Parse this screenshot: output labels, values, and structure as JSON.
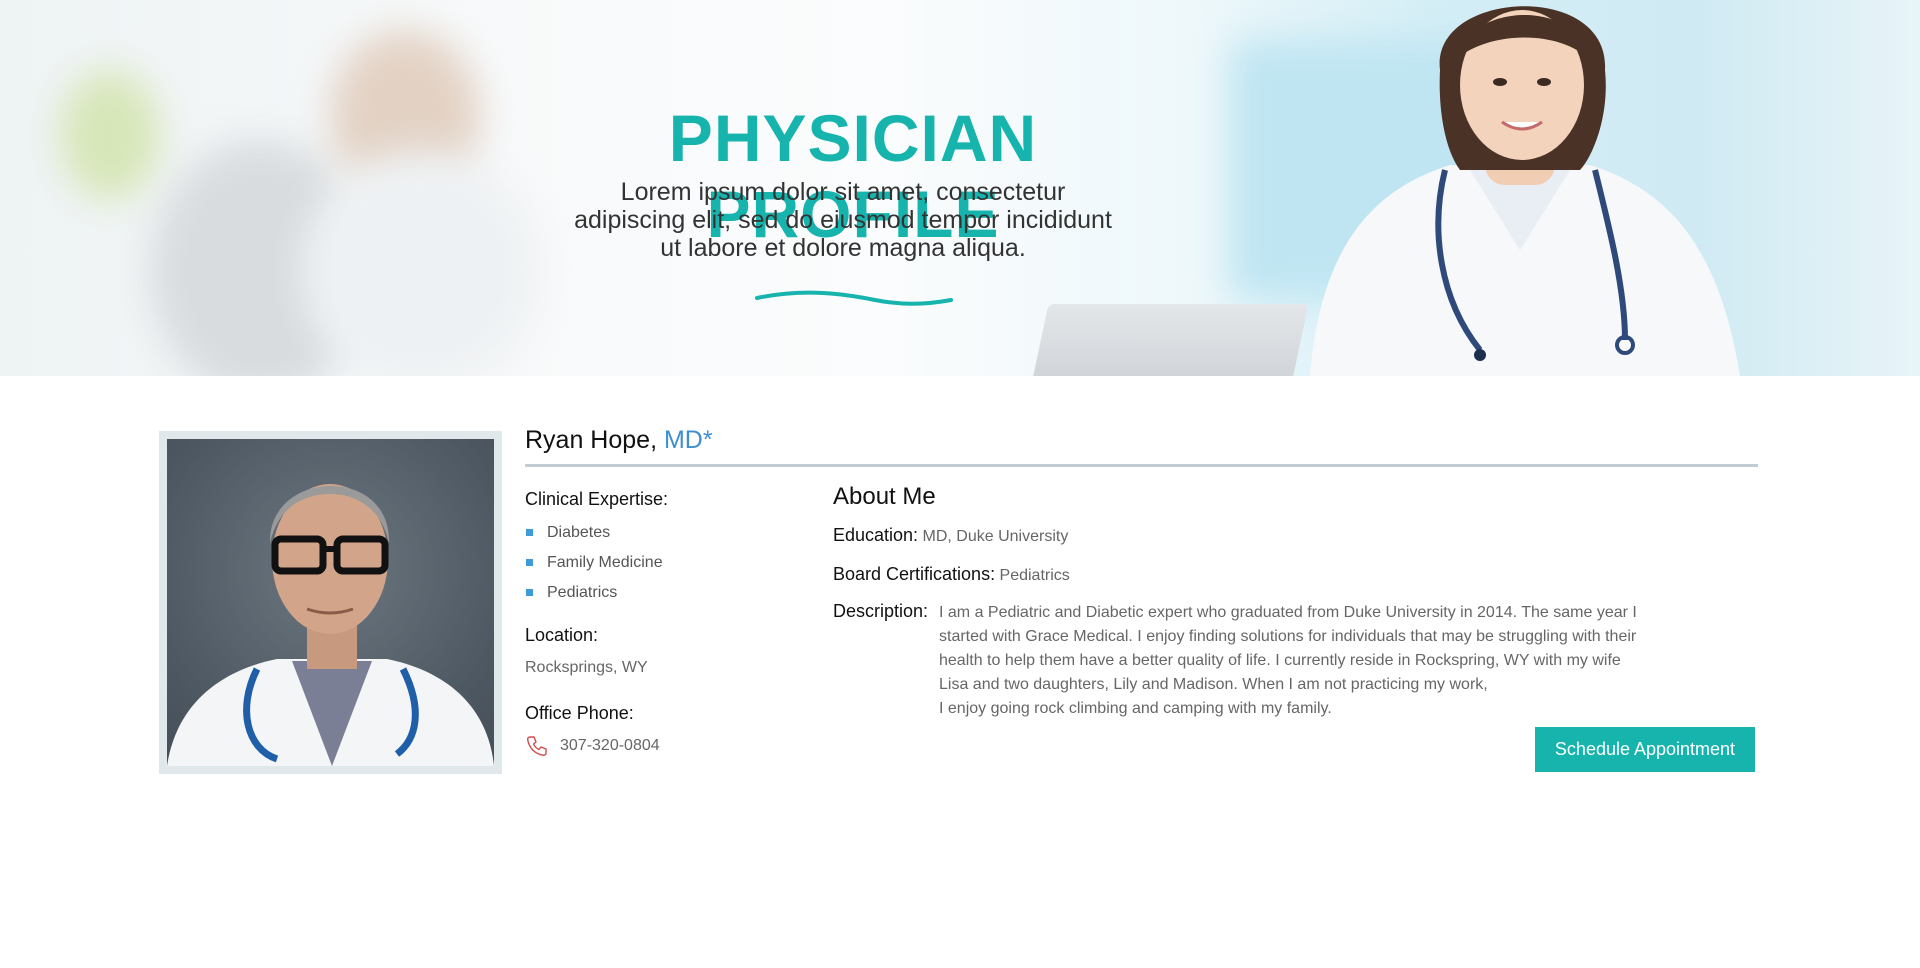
{
  "hero": {
    "title": "PHYSICIAN PROFILE",
    "subtitle_lines": [
      "Lorem ipsum dolor sit amet, consectetur",
      "adipiscing elit, sed do eiusmod tempor incididunt",
      "ut labore et dolore magna aliqua."
    ]
  },
  "profile": {
    "name": "Ryan Hope,",
    "credential": "MD*",
    "clinical_expertise_label": "Clinical Expertise:",
    "expertise": [
      "Diabetes",
      "Family Medicine",
      "Pediatrics"
    ],
    "location_label": "Location:",
    "location": "Rocksprings, WY",
    "phone_label": "Office Phone:",
    "phone": "307-320-0804"
  },
  "about": {
    "title": "About Me",
    "education_label": "Education:",
    "education": "MD, Duke University",
    "board_label": "Board Certifications:",
    "board": "Pediatrics",
    "description_label": "Description:",
    "description_lines": [
      "I am a Pediatric and Diabetic expert who graduated from Duke University in 2014. The same year I",
      "started with Grace Medical. I enjoy finding solutions for individuals that may be struggling with their",
      "health to help them have a better quality of life. I currently reside in Rockspring, WY with my wife",
      "Lisa and two daughters, Lily and Madison. When I am not practicing my work,",
      "I enjoy going rock climbing and camping with my family."
    ]
  },
  "actions": {
    "schedule_label": "Schedule Appointment"
  },
  "colors": {
    "accent": "#17b3ad",
    "link": "#3e8ed0",
    "rule": "#c3ccd3"
  },
  "icons": {
    "phone": "phone-icon",
    "bullet": "square-bullet-icon"
  }
}
